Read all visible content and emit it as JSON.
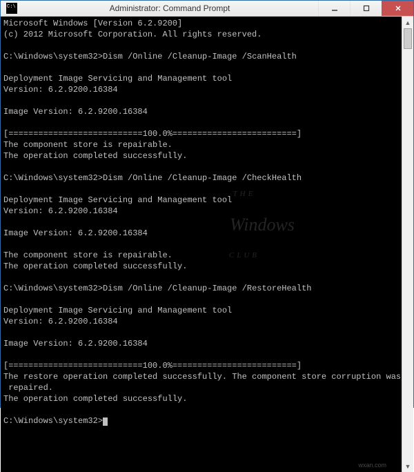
{
  "window": {
    "title": "Administrator: Command Prompt"
  },
  "console": {
    "lines": {
      "l0": "Microsoft Windows [Version 6.2.9200]",
      "l1": "(c) 2012 Microsoft Corporation. All rights reserved.",
      "l2": "",
      "l3p": "C:\\Windows\\system32>",
      "l3c": "Dism /Online /Cleanup-Image /ScanHealth",
      "l4": "",
      "l5": "Deployment Image Servicing and Management tool",
      "l6": "Version: 6.2.9200.16384",
      "l7": "",
      "l8": "Image Version: 6.2.9200.16384",
      "l9": "",
      "l10": "[===========================100.0%=========================]",
      "l11": "The component store is repairable.",
      "l12": "The operation completed successfully.",
      "l13": "",
      "l14p": "C:\\Windows\\system32>",
      "l14c": "Dism /Online /Cleanup-Image /CheckHealth",
      "l15": "",
      "l16": "Deployment Image Servicing and Management tool",
      "l17": "Version: 6.2.9200.16384",
      "l18": "",
      "l19": "Image Version: 6.2.9200.16384",
      "l20": "",
      "l21": "The component store is repairable.",
      "l22": "The operation completed successfully.",
      "l23": "",
      "l24p": "C:\\Windows\\system32>",
      "l24c": "Dism /Online /Cleanup-Image /RestoreHealth",
      "l25": "",
      "l26": "Deployment Image Servicing and Management tool",
      "l27": "Version: 6.2.9200.16384",
      "l28": "",
      "l29": "Image Version: 6.2.9200.16384",
      "l30": "",
      "l31": "[===========================100.0%=========================]",
      "l32": "The restore operation completed successfully. The component store corruption was",
      "l33": " repaired.",
      "l34": "The operation completed successfully.",
      "l35": "",
      "l36p": "C:\\Windows\\system32>"
    }
  },
  "watermark": {
    "top": "THE",
    "main": "Windows",
    "bottom": "CLUB"
  },
  "footer": "wxan.com"
}
